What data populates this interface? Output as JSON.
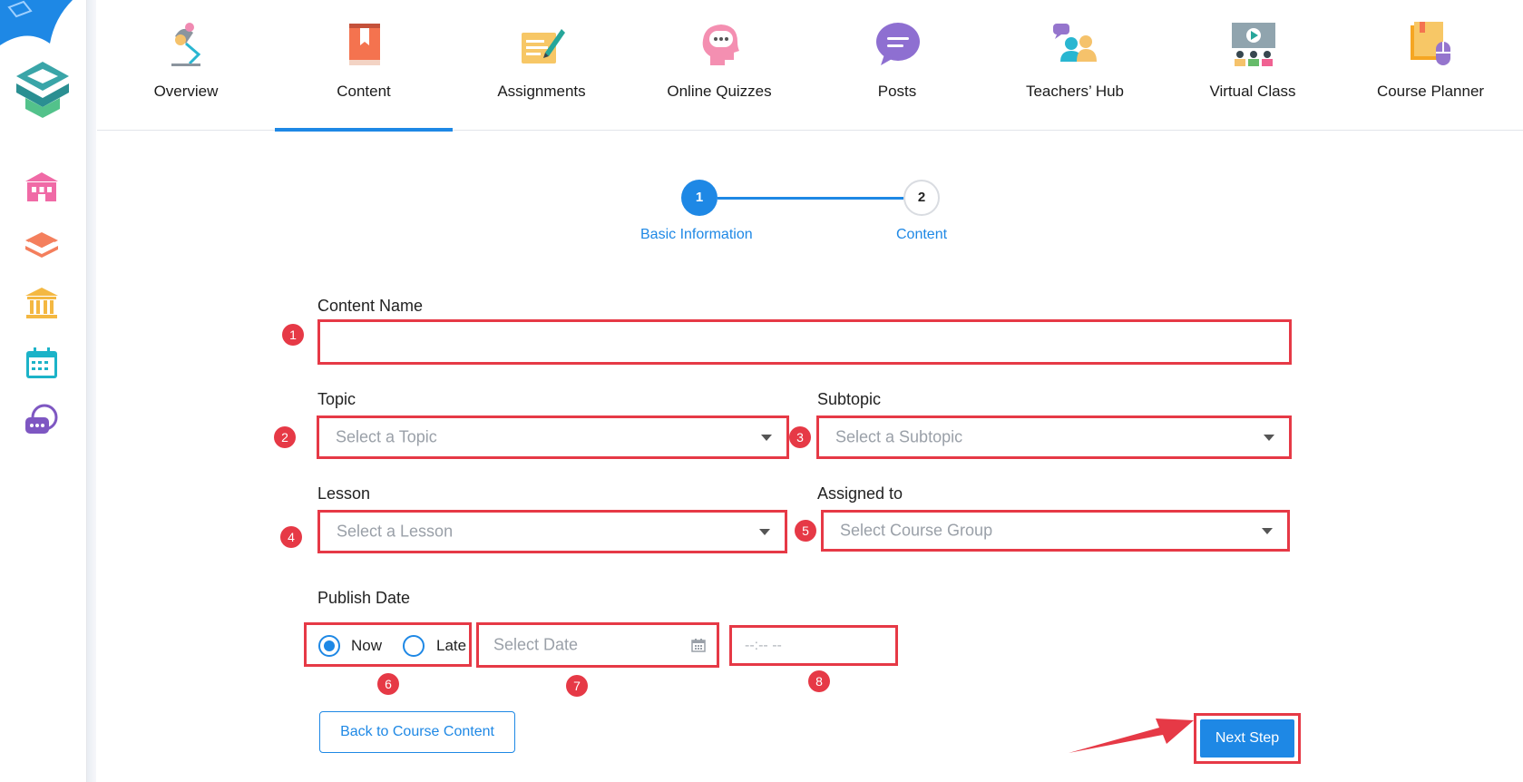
{
  "nav": {
    "tabs": [
      {
        "label": "Overview",
        "icon": "desk-lamp-icon"
      },
      {
        "label": "Content",
        "icon": "book-icon"
      },
      {
        "label": "Assignments",
        "icon": "pen-paper-icon"
      },
      {
        "label": "Online Quizzes",
        "icon": "head-chat-icon"
      },
      {
        "label": "Posts",
        "icon": "speech-bubble-icon"
      },
      {
        "label": "Teachers’ Hub",
        "icon": "teachers-group-icon"
      },
      {
        "label": "Virtual Class",
        "icon": "virtual-classroom-icon"
      },
      {
        "label": "Course Planner",
        "icon": "planner-icon"
      }
    ],
    "active_tab": "Content"
  },
  "sidebar": {
    "icons": [
      "school-icon",
      "layers-icon",
      "institution-icon",
      "calendar-icon",
      "chat-icon"
    ]
  },
  "stepper": {
    "steps": [
      {
        "number": "1",
        "label": "Basic Information"
      },
      {
        "number": "2",
        "label": "Content"
      }
    ],
    "current": 1
  },
  "form": {
    "content_name_label": "Content Name",
    "content_name_value": "",
    "topic_label": "Topic",
    "topic_placeholder": "Select a Topic",
    "subtopic_label": "Subtopic",
    "subtopic_placeholder": "Select a Subtopic",
    "lesson_label": "Lesson",
    "lesson_placeholder": "Select a Lesson",
    "assigned_label": "Assigned to",
    "assigned_placeholder": "Select Course Group",
    "publish_label": "Publish Date",
    "publish_now": "Now",
    "publish_late": "Late",
    "publish_selected": "Now",
    "date_placeholder": "Select Date",
    "time_placeholder": "--:-- --"
  },
  "badges": [
    "1",
    "2",
    "3",
    "4",
    "5",
    "6",
    "7",
    "8"
  ],
  "buttons": {
    "back": "Back to Course Content",
    "next": "Next Step"
  },
  "colors": {
    "accent": "#1e88e5",
    "highlight": "#e63946"
  }
}
